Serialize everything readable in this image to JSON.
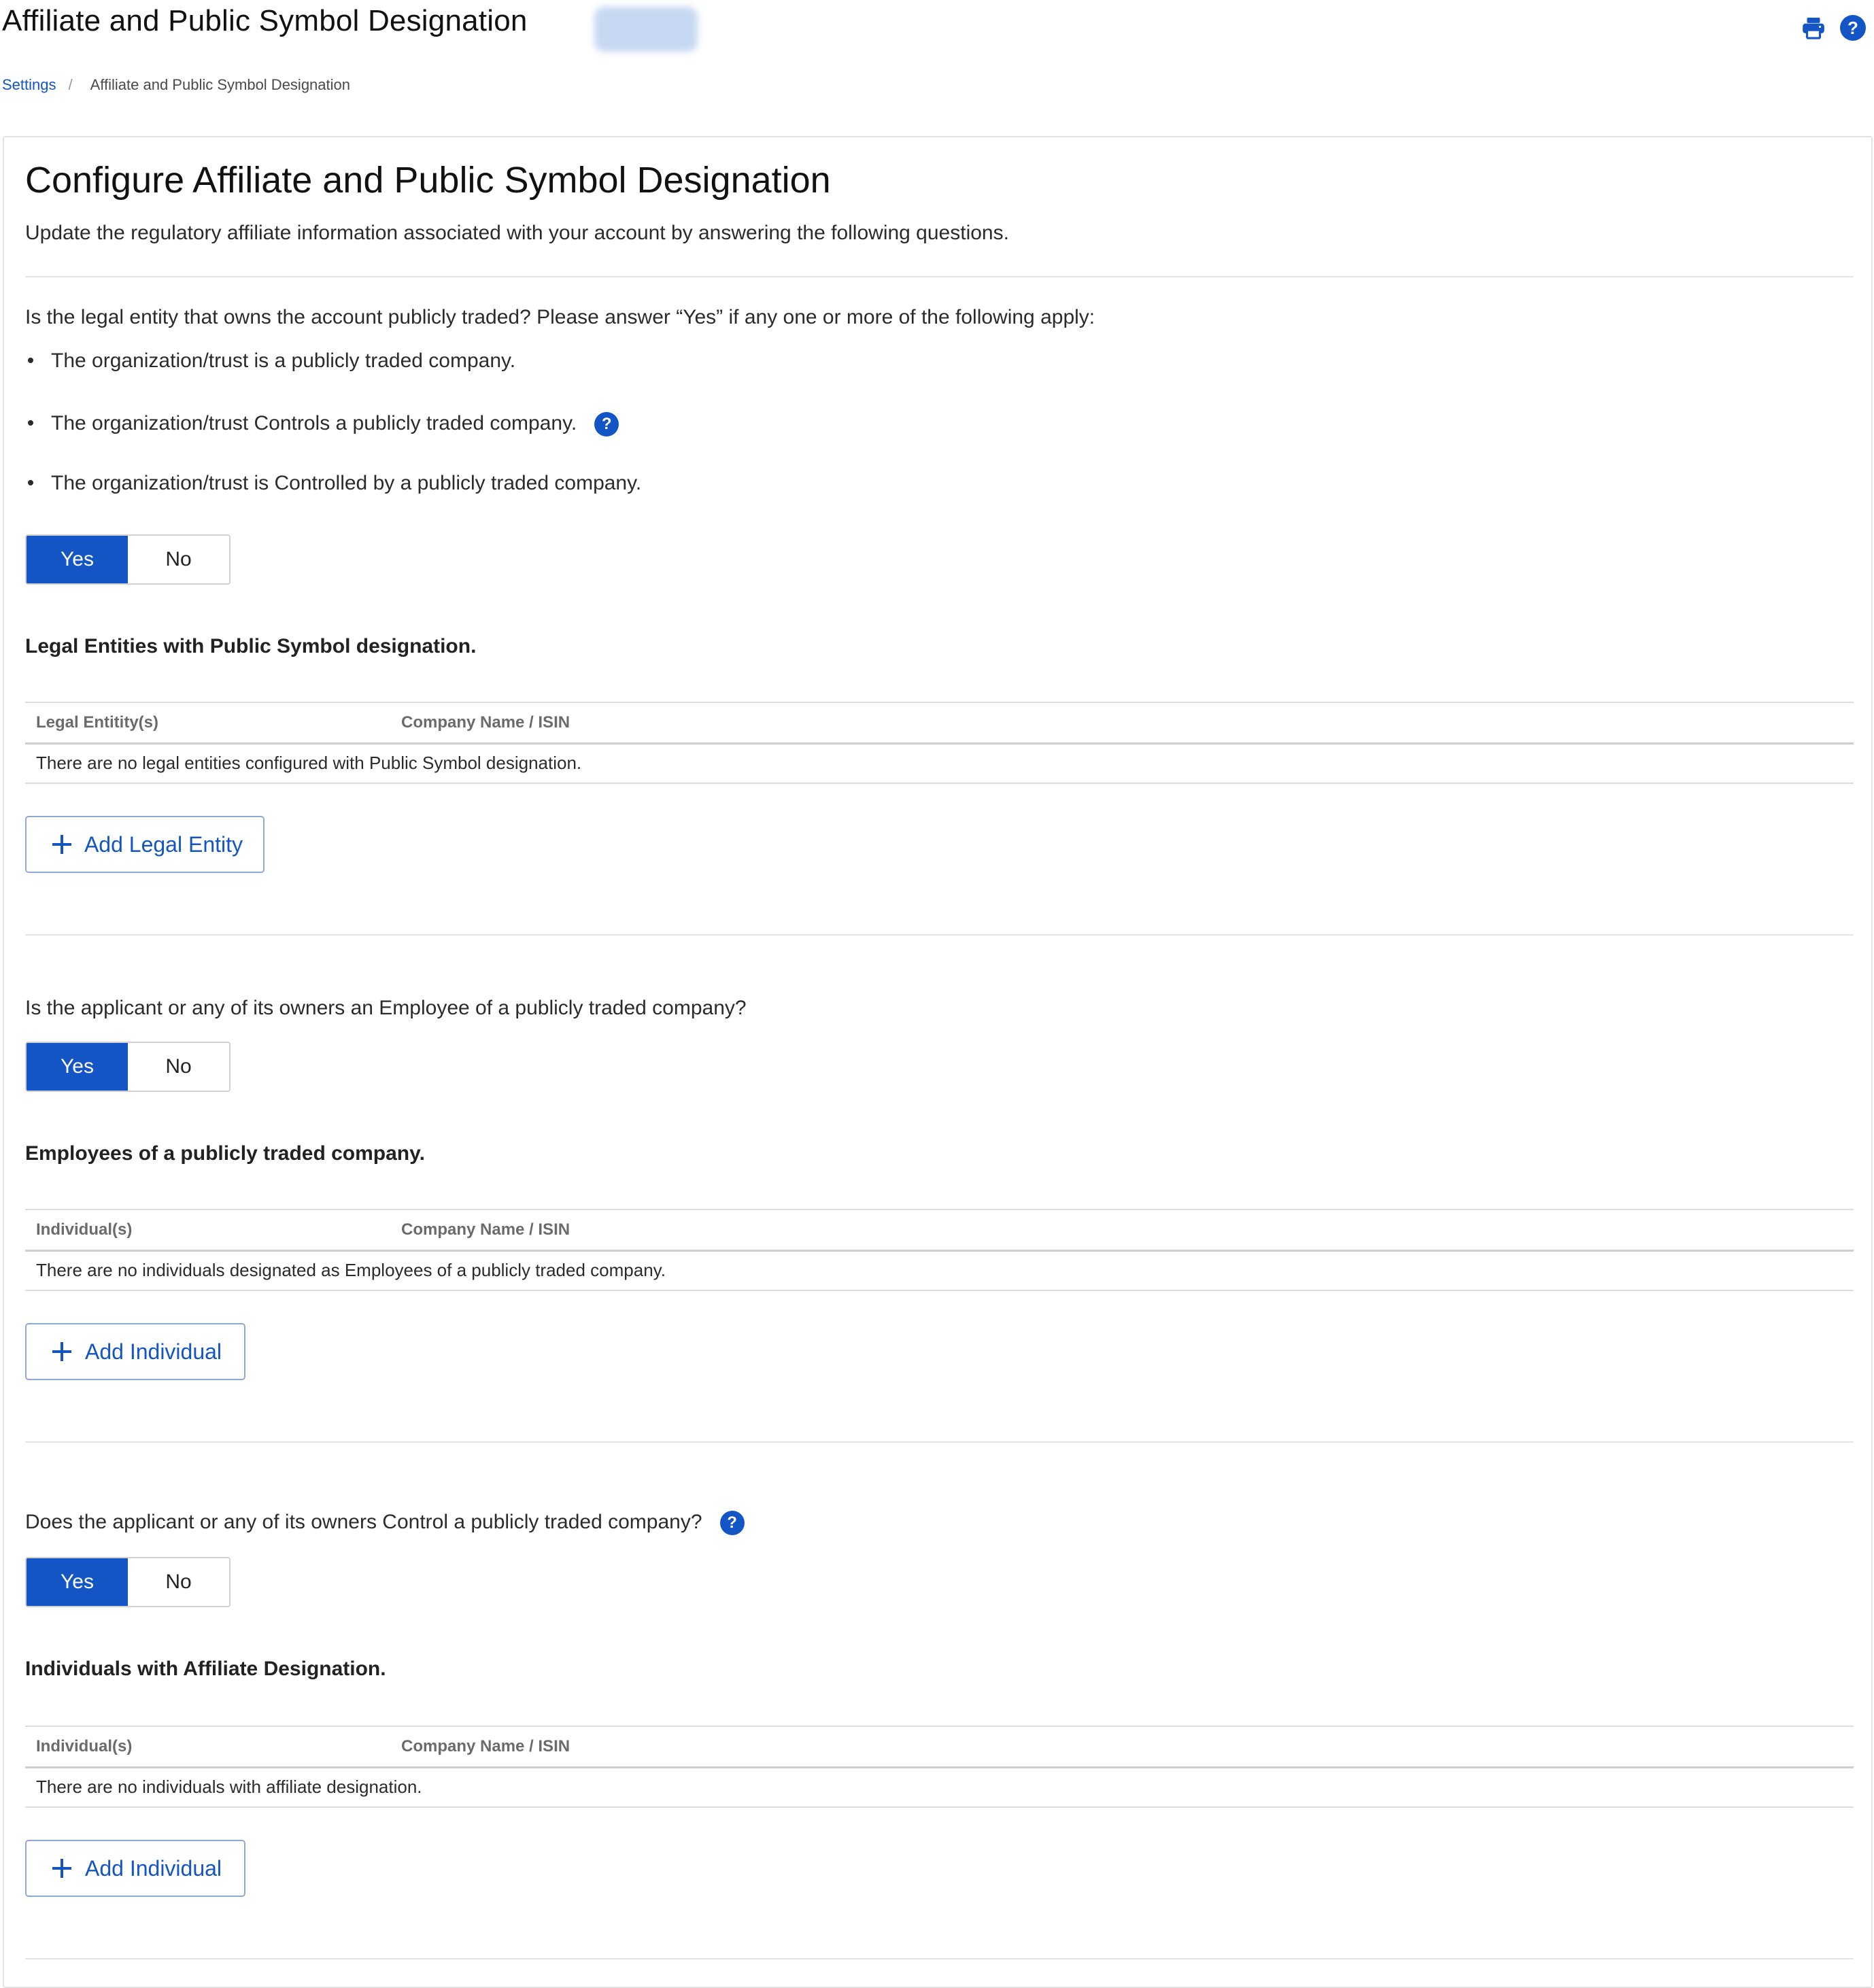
{
  "header": {
    "title": "Affiliate and Public Symbol Designation",
    "icons": [
      "print-icon",
      "help-icon"
    ]
  },
  "breadcrumb": {
    "items": [
      "Settings",
      "Affiliate and Public Symbol Designation"
    ],
    "separator": "/"
  },
  "main": {
    "title": "Configure Affiliate and Public Symbol Designation",
    "description": "Update the regulatory affiliate information associated with your account by answering the following questions."
  },
  "section1": {
    "question": "Is the legal entity that owns the account publicly traded? Please answer “Yes” if any one or more of the following apply:",
    "bullets": [
      "The organization/trust is a publicly traded company.",
      "The organization/trust Controls a publicly traded company.",
      "The organization/trust is Controlled by a publicly traded company."
    ],
    "toggle": {
      "yes": "Yes",
      "no": "No",
      "selected": "Yes"
    },
    "heading": "Legal Entities with Public Symbol designation.",
    "columns": [
      "Legal Entitity(s)",
      "Company Name / ISIN"
    ],
    "empty_text": "There are no legal entities configured with Public Symbol designation.",
    "add_label": "Add Legal Entity"
  },
  "section2": {
    "question": "Is the applicant or any of its owners an Employee of a publicly traded company?",
    "toggle": {
      "yes": "Yes",
      "no": "No",
      "selected": "Yes"
    },
    "heading": "Employees of a publicly traded company.",
    "columns": [
      "Individual(s)",
      "Company Name / ISIN"
    ],
    "empty_text": "There are no individuals designated as Employees of a publicly traded company.",
    "add_label": "Add Individual"
  },
  "section3": {
    "question": "Does the applicant or any of its owners Control a publicly traded company?",
    "toggle": {
      "yes": "Yes",
      "no": "No",
      "selected": "Yes"
    },
    "heading": "Individuals with Affiliate Designation.",
    "columns": [
      "Individual(s)",
      "Company Name / ISIN"
    ],
    "empty_text": "There are no individuals with affiliate designation.",
    "add_label": "Add Individual"
  },
  "colors": {
    "accent": "#1455c5",
    "border": "#d2d2d2",
    "text": "#2b2b2b"
  }
}
